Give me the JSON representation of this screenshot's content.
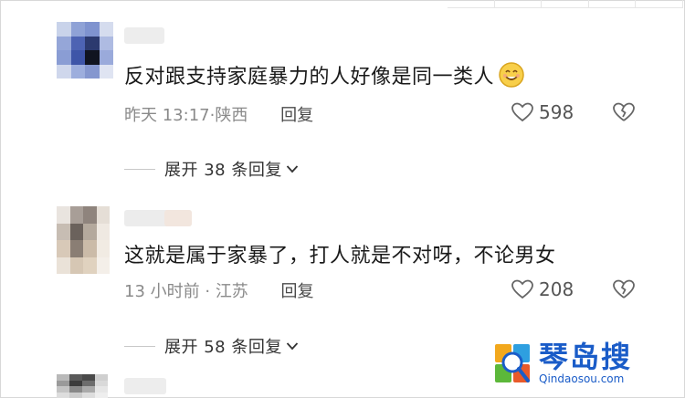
{
  "comments": [
    {
      "text": "反对跟支持家庭暴力的人好像是同一类人",
      "time": "昨天 13:17",
      "location": "陕西",
      "reply_label": "回复",
      "likes": "598",
      "has_emoji": true,
      "expand_label": "展开 38 条回复"
    },
    {
      "text": "这就是属于家暴了，打人就是不对呀，不论男女",
      "time": "13 小时前",
      "location": "江苏",
      "reply_label": "回复",
      "likes": "208",
      "expand_label": "展开 58 条回复"
    }
  ],
  "watermark": {
    "title": "琴岛搜",
    "url": "Qindaosou.com"
  },
  "colors": {
    "text": "#1a1a1a",
    "meta": "#8a8a8a",
    "watermark": "#1a5cc8"
  }
}
